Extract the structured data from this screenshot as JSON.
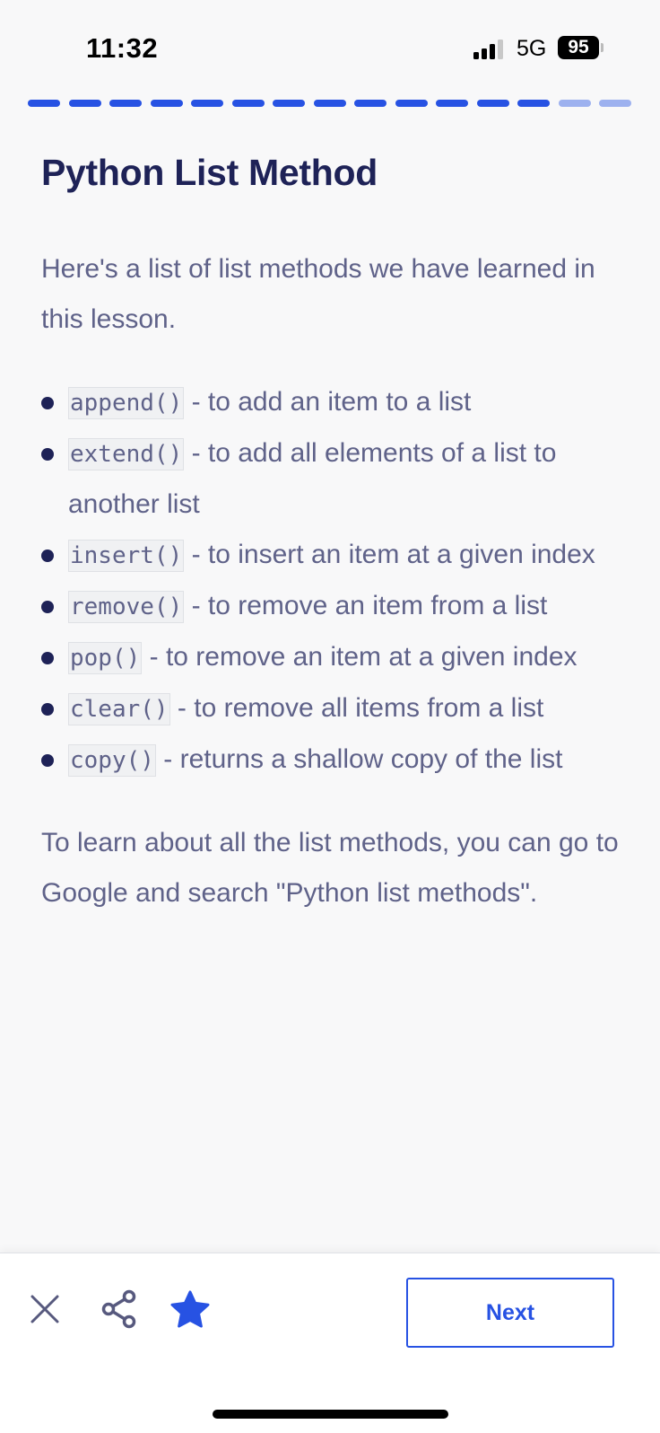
{
  "status_bar": {
    "time": "11:32",
    "network": "5G",
    "battery": "95",
    "signal_bars_active": 3,
    "signal_bars_total": 4
  },
  "progress": {
    "completed_steps": 13,
    "total_steps": 15,
    "done_color": "#2752e3",
    "pending_color": "#9db1ef"
  },
  "lesson": {
    "title": "Python List Method",
    "intro": "Here's a list of list methods we have learned in this lesson.",
    "methods": [
      {
        "code": "append()",
        "description": " - to add an item to a list"
      },
      {
        "code": "extend()",
        "description": " - to add all elements of a list to another list"
      },
      {
        "code": "insert()",
        "description": " - to insert an item at a given index"
      },
      {
        "code": "remove()",
        "description": " - to remove an item from a list"
      },
      {
        "code": "pop()",
        "description": " - to remove an item at a given index"
      },
      {
        "code": "clear()",
        "description": " - to remove all items from a list"
      },
      {
        "code": "copy()",
        "description": " - returns a shallow copy of the list"
      }
    ],
    "outro": "To learn about all the list methods, you can go to Google and search \"Python list methods\"."
  },
  "bottom_bar": {
    "close_icon": "close-icon",
    "share_icon": "share-icon",
    "star_icon": "star-icon",
    "star_color": "#2752e3",
    "next_label": "Next"
  }
}
